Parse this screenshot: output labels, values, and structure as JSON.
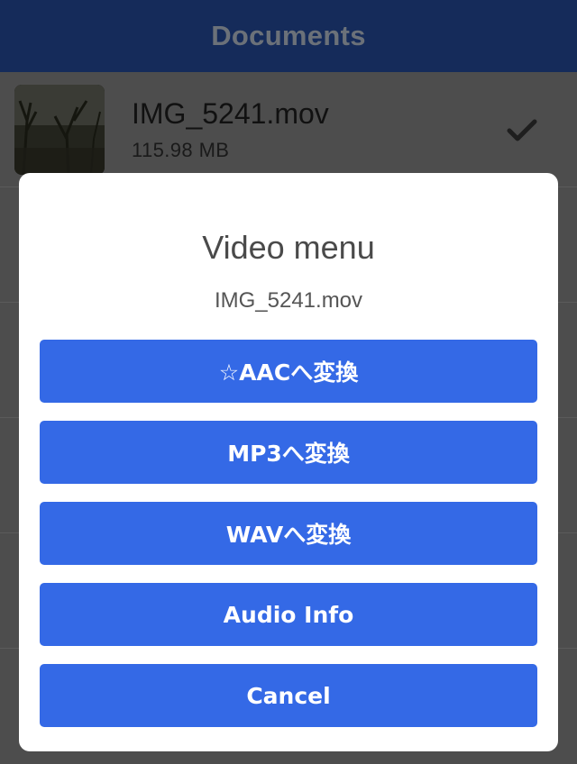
{
  "nav": {
    "title": "Documents"
  },
  "documents": [
    {
      "name": "IMG_5241.mov",
      "size": "115.98 MB",
      "status_icon": "checkmark-icon"
    }
  ],
  "dialog": {
    "title": "Video menu",
    "subtitle": "IMG_5241.mov",
    "buttons": [
      {
        "label": "☆AACへ変換"
      },
      {
        "label": "MP3へ変換"
      },
      {
        "label": "WAVへ変換"
      },
      {
        "label": "Audio Info"
      },
      {
        "label": "Cancel"
      }
    ]
  },
  "colors": {
    "nav_background": "#152b5a",
    "overlay": "#4d4d4d",
    "button": "#3469e6",
    "dialog_background": "#ffffff"
  }
}
